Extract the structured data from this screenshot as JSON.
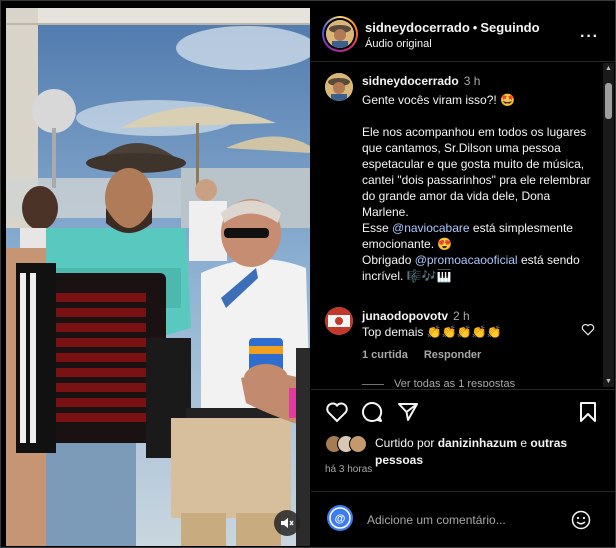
{
  "post": {
    "username": "sidneydocerrado",
    "follow_status": "Seguindo",
    "audio": "Áudio original"
  },
  "caption": {
    "username": "sidneydocerrado",
    "time": "3 h",
    "line1": "Gente vocês viram isso?! 🤩",
    "para2": "Ele nos acompanhou em todos os lugares que cantamos, Sr.Dilson uma pessoa espetacular e que gosta muito de música, cantei \"dois passarinhos\" pra ele relembrar  do grande amor da vida dele, Dona Marlene.",
    "esse": "Esse ",
    "mention1": "@naviocabare",
    "after_mention1": " está simplesmente emocionante. 😍",
    "obrigado": "Obrigado ",
    "mention2": "@promoacaooficial",
    "after_mention2": " está sendo incrível. 🎼🎶🎹"
  },
  "comment": {
    "username": "junaodopovotv",
    "time": "2 h",
    "text": "Top demais 👏👏👏👏👏",
    "likes": "1 curtida",
    "reply": "Responder",
    "view_replies": "Ver todas as 1 respostas"
  },
  "likes": {
    "prefix": "Curtido por ",
    "user": "danizinhazum",
    "and": " e ",
    "others": "outras pessoas"
  },
  "date": "há 3 horas",
  "composer": {
    "placeholder": "Adicione um comentário..."
  },
  "icons": {
    "more": "more-horizontal-icon",
    "heart": "heart-icon",
    "comment": "comment-icon",
    "share": "share-icon",
    "save": "bookmark-icon",
    "emoji": "emoji-icon",
    "mute": "speaker-muted-icon"
  }
}
